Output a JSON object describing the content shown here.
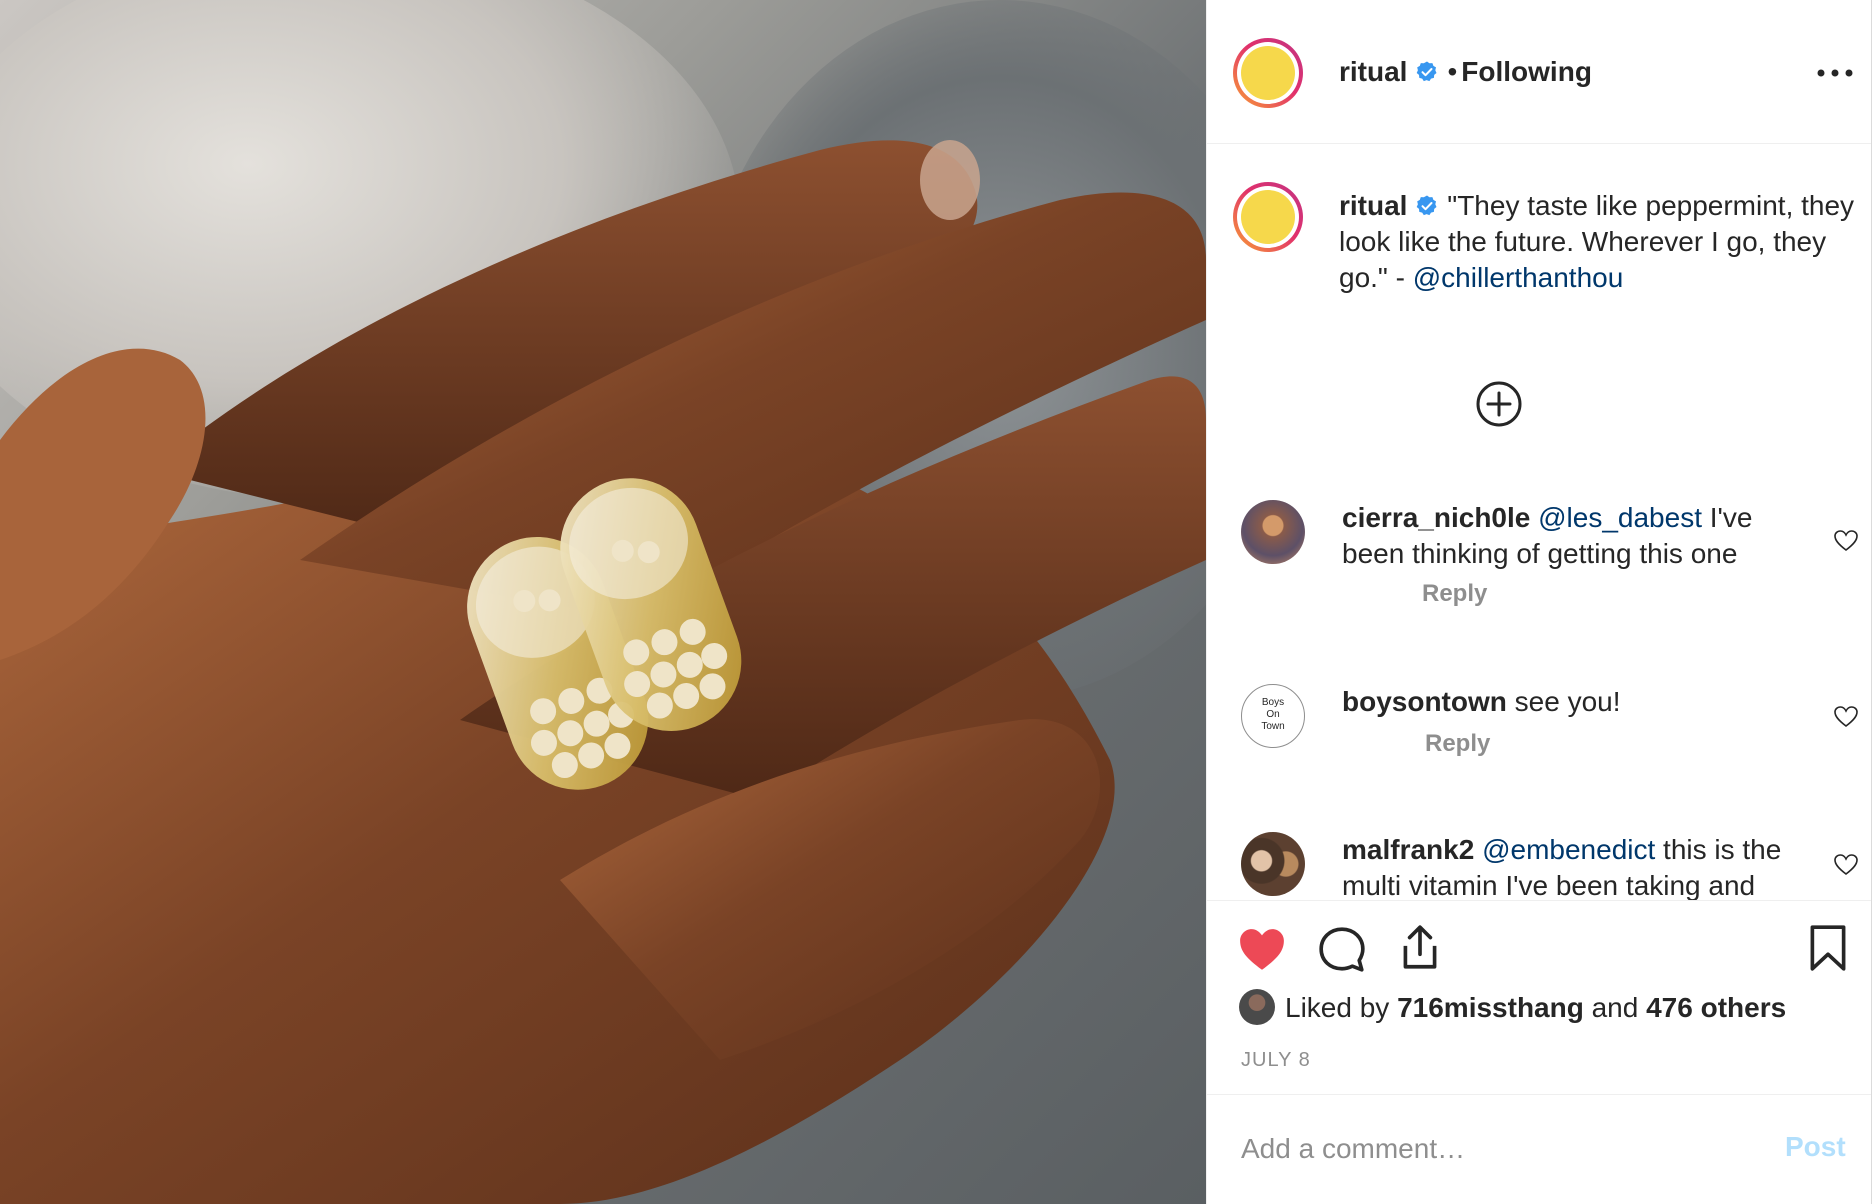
{
  "header": {
    "username": "ritual",
    "separator": "•",
    "follow_status": "Following",
    "verified_icon": "verified-badge-icon",
    "more_icon": "more-options-icon",
    "avatar_color": "#f6d84b"
  },
  "caption": {
    "username": "ritual",
    "text": "\"They taste like peppermint, they look like the future. Wherever I go, they go.\" - ",
    "mention": "@chillerthanthou"
  },
  "load_more_icon": "plus-circle-icon",
  "comments": [
    {
      "username": "cierra_nich0le",
      "mention": "@les_dabest",
      "text": " I've been thinking of getting this one",
      "reply_label": "Reply"
    },
    {
      "username": "boysontown",
      "mention": "",
      "text": " see you!",
      "reply_label": "Reply",
      "avatar_text": "Boys On Town"
    },
    {
      "username": "malfrank2",
      "mention": "@embenedict",
      "text": " this is the multi vitamin I've been taking and",
      "reply_label": ""
    }
  ],
  "actions": {
    "like_icon": "heart-filled-icon",
    "comment_icon": "comment-icon",
    "share_icon": "share-icon",
    "save_icon": "bookmark-icon",
    "like_color": "#ed4956"
  },
  "likes": {
    "prefix": "Liked by ",
    "user": "716missthang",
    "middle": " and ",
    "others": "476 others"
  },
  "date": "JULY 8",
  "add_comment": {
    "placeholder": "Add a comment…",
    "post_label": "Post"
  }
}
